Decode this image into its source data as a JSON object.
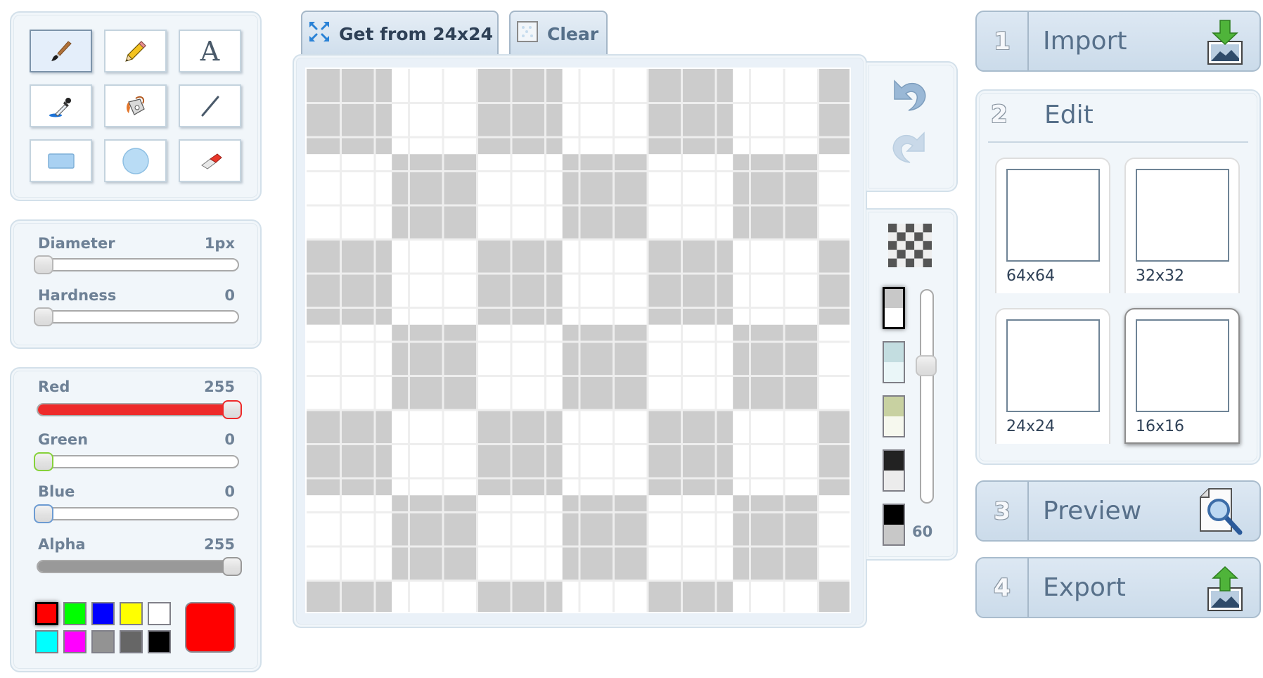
{
  "tools": [
    {
      "name": "brush",
      "icon": "paintbrush-icon",
      "active": true
    },
    {
      "name": "pencil",
      "icon": "pencil-icon",
      "active": false
    },
    {
      "name": "text",
      "icon": "text-icon",
      "glyph": "A",
      "active": false
    },
    {
      "name": "eyedropper",
      "icon": "eyedropper-icon",
      "active": false
    },
    {
      "name": "fill",
      "icon": "paint-bucket-icon",
      "active": false
    },
    {
      "name": "line",
      "icon": "line-icon",
      "active": false
    },
    {
      "name": "rectangle",
      "icon": "rectangle-icon",
      "active": false
    },
    {
      "name": "ellipse",
      "icon": "ellipse-icon",
      "active": false
    },
    {
      "name": "eraser",
      "icon": "eraser-icon",
      "active": false
    }
  ],
  "brush": {
    "diameter": {
      "label": "Diameter",
      "value": "1px",
      "fraction": 0.0
    },
    "hardness": {
      "label": "Hardness",
      "value": "0",
      "fraction": 0.0
    }
  },
  "color": {
    "red": {
      "label": "Red",
      "value": "255",
      "fraction": 1.0,
      "accent": "#ee2a2a"
    },
    "green": {
      "label": "Green",
      "value": "0",
      "fraction": 0.0,
      "accent": "#86d13a"
    },
    "blue": {
      "label": "Blue",
      "value": "0",
      "fraction": 0.0,
      "accent": "#6c9bd2"
    },
    "alpha": {
      "label": "Alpha",
      "value": "255",
      "fraction": 1.0,
      "accent": "#999999"
    },
    "palette": [
      "#ff0000",
      "#00ff00",
      "#0000ff",
      "#ffff00",
      "#ffffff",
      "#00ffff",
      "#ff00ff",
      "#939393",
      "#666666",
      "#000000"
    ],
    "selected_index": 0,
    "current": "#ff0000"
  },
  "tabs": {
    "get_from": {
      "label": "Get from 24x24",
      "icon": "resize-arrows-icon"
    },
    "clear": {
      "label": "Clear",
      "icon": "clear-canvas-icon"
    }
  },
  "canvas": {
    "pixel_size": "16x16",
    "checker_colors": [
      "#cccccc",
      "#ffffff"
    ],
    "grid_line_color": "#eeeeee"
  },
  "history": {
    "undo": {
      "icon": "undo-icon",
      "enabled": true
    },
    "redo": {
      "icon": "redo-icon",
      "enabled": false
    }
  },
  "background": {
    "pattern_icon": "checkerboard-icon",
    "swatches": [
      {
        "top": "#c8c8c8",
        "bottom": "#ffffff",
        "selected": true
      },
      {
        "top": "#c3dde0",
        "bottom": "#eaf6f8",
        "selected": false
      },
      {
        "top": "#c8d1a1",
        "bottom": "#f6f8ee",
        "selected": false
      },
      {
        "top": "#222222",
        "bottom": "#ececec",
        "selected": false
      },
      {
        "top": "#000000",
        "bottom": "#c8c8c8",
        "selected": false
      }
    ],
    "grid_opacity": {
      "value": "60",
      "fraction": 0.45
    }
  },
  "steps": {
    "import": {
      "number": "1",
      "label": "Import",
      "icon": "import-image-icon"
    },
    "edit": {
      "number": "2",
      "label": "Edit"
    },
    "preview": {
      "number": "3",
      "label": "Preview",
      "icon": "preview-magnifier-icon"
    },
    "export": {
      "number": "4",
      "label": "Export",
      "icon": "export-image-icon"
    }
  },
  "sizes": [
    {
      "label": "64x64",
      "selected": false
    },
    {
      "label": "32x32",
      "selected": false
    },
    {
      "label": "24x24",
      "selected": false
    },
    {
      "label": "16x16",
      "selected": true
    }
  ]
}
